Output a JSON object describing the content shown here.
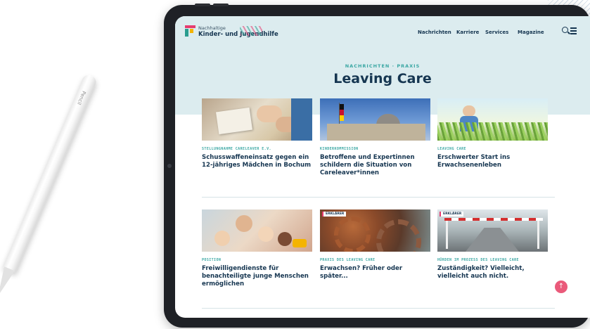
{
  "pencil": {
    "label": "Pencil"
  },
  "site": {
    "logo_line1": "Nachhaltige",
    "logo_line2": "Kinder- und Jugendhilfe",
    "nav": [
      "Nachrichten",
      "Karriere",
      "Services",
      "Magazine"
    ]
  },
  "breadcrumb": "NACHRICHTEN · PRAXIS",
  "page_title": "Leaving Care",
  "cards": [
    {
      "category": "STELLUNGNAHME CARELEAVER E.V.",
      "title": "Schusswaffeneinsatz gegen ein 12-jähriges Mädchen in Bochum",
      "badge": ""
    },
    {
      "category": "KINDERKOMMISSION",
      "title": "Betroffene und Expertinnen schildern die Situation von Careleaver*innen",
      "badge": ""
    },
    {
      "category": "LEAVING CARE",
      "title": "Erschwerter Start ins Erwachsenenleben",
      "badge": ""
    },
    {
      "category": "POSITION",
      "title": "Freiwilligendienste für benachteiligte junge Menschen ermöglichen",
      "badge": ""
    },
    {
      "category": "PRAXIS DES LEAVING CARE",
      "title": "Erwachsen? Früher oder später...",
      "badge": "ERKLÄRER"
    },
    {
      "category": "HÜRDEN IM PROZESS DES LEAVING CARE",
      "title": "Zuständigkeit? Vielleicht, vielleicht auch nicht.",
      "badge": "ERKLÄRER"
    }
  ],
  "back_to_top": "↑",
  "colors": {
    "accent": "#3aa7a3",
    "brand": "#163651",
    "highlight": "#e63b6f",
    "hero_bg": "#dcecef"
  }
}
